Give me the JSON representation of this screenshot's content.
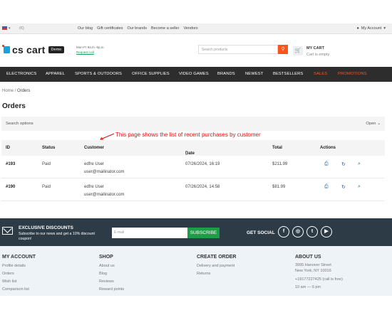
{
  "topbar": {
    "currency": "(€)",
    "links": [
      "Our blog",
      "Gift certificates",
      "Our brands",
      "Become a seller",
      "Vendors"
    ],
    "account_label": "My Account"
  },
  "header": {
    "logo_text": "cs cart",
    "demo_badge": "Demo",
    "hours": "Mon-Fr 9a.m.-6p.m.",
    "request_call": "Request call",
    "search_placeholder": "Search products",
    "cart_title": "MY CART",
    "cart_status": "Cart is empty"
  },
  "nav": {
    "items": [
      "ELECTRONICS",
      "APPAREL",
      "SPORTS & OUTDOORS",
      "OFFICE SUPPLIES",
      "VIDEO GAMES",
      "BRANDS",
      "NEWEST",
      "BESTSELLERS",
      "SALES",
      "PROMOTIONS"
    ]
  },
  "breadcrumb": {
    "home": "Home",
    "sep": "/",
    "current": "Orders"
  },
  "page_title": "Orders",
  "search_options": {
    "label": "Search options",
    "status": "Open"
  },
  "annotation": "This page shows the list of recent purchases by customer",
  "table": {
    "headers": [
      "ID",
      "Status",
      "Customer",
      "Date",
      "Total",
      "Actions"
    ],
    "rows": [
      {
        "id": "#193",
        "status": "Paid",
        "customer_name": "edfre User",
        "customer_email": "user@mailinator.com",
        "date": "07/26/2024, 16:19",
        "total": "$211.99"
      },
      {
        "id": "#190",
        "status": "Paid",
        "customer_name": "edfre User",
        "customer_email": "user@mailinator.com",
        "date": "07/26/2024, 14:58",
        "total": "$81.99"
      }
    ]
  },
  "promo": {
    "heading": "EXCLUSIVE DISCOUNTS",
    "description": "Subscribe to our news and get a 10% discount coupon!",
    "email_placeholder": "E-mail",
    "subscribe_label": "SUBSCRIBE",
    "social_label": "GET SOCIAL"
  },
  "footer": {
    "columns": [
      {
        "heading": "MY ACCOUNT",
        "items": [
          "Profile details",
          "Orders",
          "Wish list",
          "Comparison list"
        ]
      },
      {
        "heading": "SHOP",
        "items": [
          "About us",
          "Blog",
          "Reviews",
          "Reward points"
        ]
      },
      {
        "heading": "CREATE ORDER",
        "items": [
          "Delivery and payment",
          "Returns"
        ]
      },
      {
        "heading": "ABOUT US",
        "items": [
          "3995 Hanover Street",
          "New York, NY 10016",
          "+19177227425 (call is free)",
          "10 am — 6 pm"
        ]
      }
    ]
  },
  "colors": {
    "accent": "#ff5319",
    "nav_bg": "#2d2d2d",
    "promo_bg": "#2c3b46",
    "subscribe": "#1c9e46",
    "annotation": "#d11111"
  }
}
